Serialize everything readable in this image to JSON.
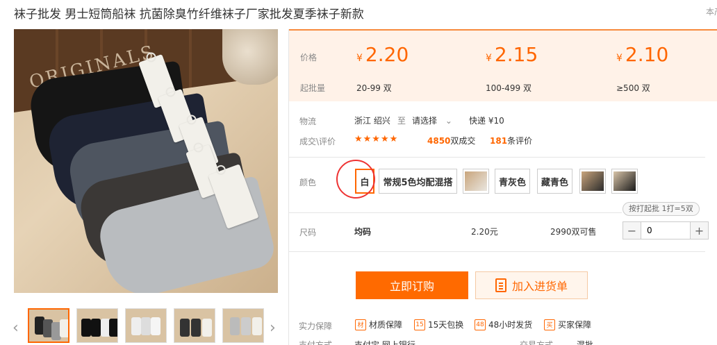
{
  "product": {
    "title": "袜子批发 男士短筒船袜 抗菌除臭竹纤维袜子厂家批发夏季袜子新款",
    "corner_note": "本产"
  },
  "gallery": {
    "main_image_alt": "ORIGINALS",
    "thumbnails": [
      "thumb-1",
      "thumb-2",
      "thumb-3",
      "thumb-4",
      "thumb-5"
    ],
    "prev_icon": "chevron-left-icon",
    "next_icon": "chevron-right-icon"
  },
  "pricing": {
    "price_label": "价格",
    "moq_label": "起批量",
    "currency": "¥",
    "tiers": [
      {
        "price": "2.20",
        "range": "20-99 双"
      },
      {
        "price": "2.15",
        "range": "100-499 双"
      },
      {
        "price": "2.10",
        "range": "≥500 双"
      }
    ]
  },
  "logistics": {
    "label": "物流",
    "origin": "浙江 绍兴",
    "to": "至",
    "destination": "请选择",
    "shipping": "快递 ¥10"
  },
  "reviews": {
    "label": "成交\\评价",
    "rating_stars": 4.5,
    "stars_text": "★★★★★",
    "deals_count": "4850",
    "deals_suffix": "双成交",
    "review_count": "181",
    "review_suffix": "条评价"
  },
  "color": {
    "label": "颜色",
    "options": [
      {
        "text": "白",
        "selected": true
      },
      {
        "text": "常规5色均配混搭"
      },
      {
        "image": "swatch-1"
      },
      {
        "text": "青灰色"
      },
      {
        "text": "藏青色"
      },
      {
        "image": "swatch-2"
      },
      {
        "image": "swatch-3"
      }
    ],
    "packing_note": "按打起批 1打=5双"
  },
  "size": {
    "label": "尺码",
    "value": "均码",
    "price": "2.20元",
    "stock": "2990双可售",
    "quantity": "0",
    "minus": "−",
    "plus": "+"
  },
  "actions": {
    "buy_label": "立即订购",
    "cart_label": "加入进货单"
  },
  "guarantees": {
    "label": "实力保障",
    "items": [
      {
        "icon": "材",
        "text": "材质保障"
      },
      {
        "icon": "15",
        "text": "15天包换"
      },
      {
        "icon": "48",
        "text": "48小时发货"
      },
      {
        "icon": "买",
        "text": "买家保障"
      }
    ]
  },
  "payment": {
    "label": "支付方式",
    "value": "支付宝  网上银行",
    "trade_label": "交易方式",
    "trade_value": "混批"
  },
  "colors": {
    "accent": "#ff6600",
    "price_bg": "#fff2e8",
    "circle": "#e33333"
  }
}
